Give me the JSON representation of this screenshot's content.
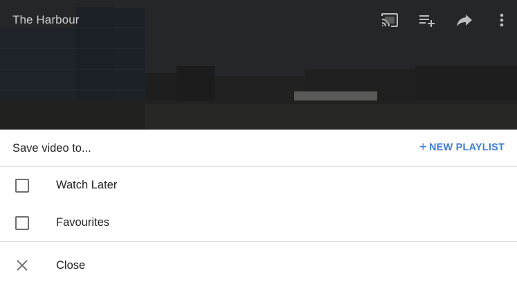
{
  "player": {
    "title": "The Harbour",
    "icons": [
      "cast-icon",
      "add-to-queue-icon",
      "share-icon",
      "more-vert-icon"
    ]
  },
  "sheet": {
    "title": "Save video to...",
    "new_playlist": "NEW PLAYLIST",
    "accent_color": "#3e7fd6",
    "playlists": [
      {
        "label": "Watch Later",
        "checked": false
      },
      {
        "label": "Favourites",
        "checked": false
      }
    ],
    "close_label": "Close"
  }
}
